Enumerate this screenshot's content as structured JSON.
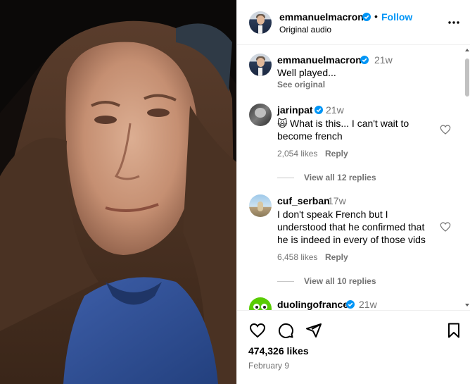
{
  "post": {
    "username": "emmanuelmacron",
    "follow_label": "Follow",
    "audio": "Original audio",
    "more_icon": "more-dots-icon"
  },
  "comments": [
    {
      "username": "emmanuelmacron",
      "time": "21w",
      "text": "Well played...",
      "see_original": "See original",
      "verified": true
    },
    {
      "username": "jarinpat",
      "time": "21w",
      "emoji": "🙀",
      "text_line1": "What is this... I can't wait to",
      "text_line2": "become french",
      "likes": "2,054 likes",
      "reply": "Reply",
      "view_replies": "View all 12 replies",
      "verified": true
    },
    {
      "username": "cuf_serban",
      "time": "17w",
      "text_line1": "I don't speak French but I",
      "text_line2": "understood that he confirmed that",
      "text_line3": "he is indeed in every of those vids",
      "likes": "6,458 likes",
      "reply": "Reply",
      "view_replies": "View all 10 replies"
    },
    {
      "username": "duolingofrance",
      "time": "21w",
      "verified": true
    }
  ],
  "footer": {
    "likes": "474,326 likes",
    "date": "February 9"
  },
  "colors": {
    "accent": "#0095f6",
    "verified": "#0095f6",
    "muted": "#737373"
  }
}
